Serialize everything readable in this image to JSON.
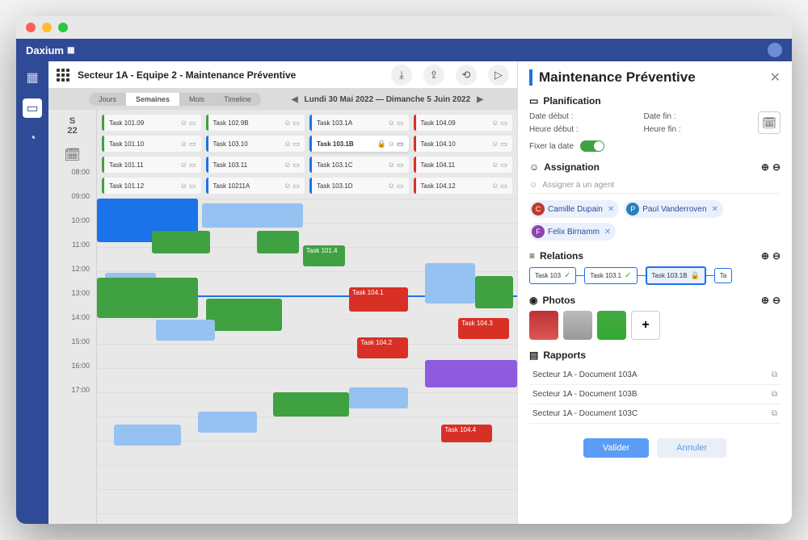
{
  "brand": "Daxium",
  "breadcrumb": "Secteur 1A - Equipe 2 - Maintenance Préventive",
  "view_tabs": {
    "jours": "Jours",
    "semaines": "Semaines",
    "mois": "Mois",
    "timeline": "Timeline"
  },
  "date_range": "Lundi 30 Mai 2022 — Dimanche 5 Juin 2022",
  "week": {
    "letter": "S",
    "num": "22"
  },
  "time_rows": [
    "08:00",
    "09:00",
    "10:00",
    "11:00",
    "12:00",
    "13:00",
    "14:00",
    "15:00",
    "16:00",
    "17:00"
  ],
  "task_chips": [
    {
      "label": "Task 101.09",
      "color": "tc-green"
    },
    {
      "label": "Task 102.9B",
      "color": "tc-green"
    },
    {
      "label": "Task 103.1A",
      "color": "tc-blue"
    },
    {
      "label": "Task 104.09",
      "color": "tc-red"
    },
    {
      "label": "Task 101.10",
      "color": "tc-green"
    },
    {
      "label": "Task 103.10",
      "color": "tc-blue"
    },
    {
      "label": "Task 103.1B",
      "color": "tc-blue",
      "hl": true
    },
    {
      "label": "Task 104.10",
      "color": "tc-red"
    },
    {
      "label": "Task 101.11",
      "color": "tc-green"
    },
    {
      "label": "Task 103.11",
      "color": "tc-blue"
    },
    {
      "label": "Task 103.1C",
      "color": "tc-blue"
    },
    {
      "label": "Task 104.11",
      "color": "tc-red"
    },
    {
      "label": "Task 101.12",
      "color": "tc-green"
    },
    {
      "label": "Task 10211A",
      "color": "tc-blue"
    },
    {
      "label": "Task 103.1D",
      "color": "tc-blue"
    },
    {
      "label": "Task 104.12",
      "color": "tc-red"
    }
  ],
  "events": {
    "e1": "Task 101.4",
    "e2": "Task 104.1",
    "e3": "Task 104.2",
    "e4": "Task 104.3",
    "e5": "Task 104.4"
  },
  "side": {
    "title": "Maintenance Préventive",
    "planification": {
      "h": "Planification",
      "date_debut": "Date début :",
      "date_fin": "Date fin :",
      "heure_debut": "Heure début :",
      "heure_fin": "Heure fin :",
      "fixer": "Fixer la date"
    },
    "assignation": {
      "h": "Assignation",
      "placeholder": "Assigner à un agent",
      "a1": "Camille Dupain",
      "a2": "Paul Vanderroven",
      "a3": "Felix Birnamm"
    },
    "relations": {
      "h": "Relations",
      "r1": "Task 103",
      "r2": "Task 103.1",
      "r3": "Task 103.1B",
      "r4": "Ta"
    },
    "photos": {
      "h": "Photos"
    },
    "rapports": {
      "h": "Rapports",
      "r1": "Secteur 1A - Document 103A",
      "r2": "Secteur 1A - Document 103B",
      "r3": "Secteur 1A - Document 103C"
    },
    "valider": "Valider",
    "annuler": "Annuler"
  }
}
